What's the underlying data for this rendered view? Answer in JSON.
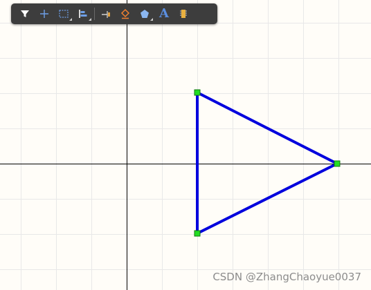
{
  "toolbar": {
    "tools": [
      {
        "icon": "filter-icon"
      },
      {
        "icon": "crosshair-icon"
      },
      {
        "icon": "selection-rect-icon"
      },
      {
        "icon": "align-icon"
      },
      {
        "icon": "pin-icon"
      },
      {
        "icon": "eraser-icon"
      },
      {
        "icon": "polygon-icon"
      },
      {
        "icon": "text-tool-icon",
        "glyph": "A"
      },
      {
        "icon": "component-icon"
      }
    ]
  },
  "canvas": {
    "background": "#fffdf8",
    "grid_color": "#e8e8e8",
    "axis_color": "#000000"
  },
  "shape": {
    "type": "triangle",
    "stroke": "#0000dd",
    "vertex_handle_color": "#00cc00"
  },
  "watermark": "CSDN @ZhangChaoyue0037"
}
